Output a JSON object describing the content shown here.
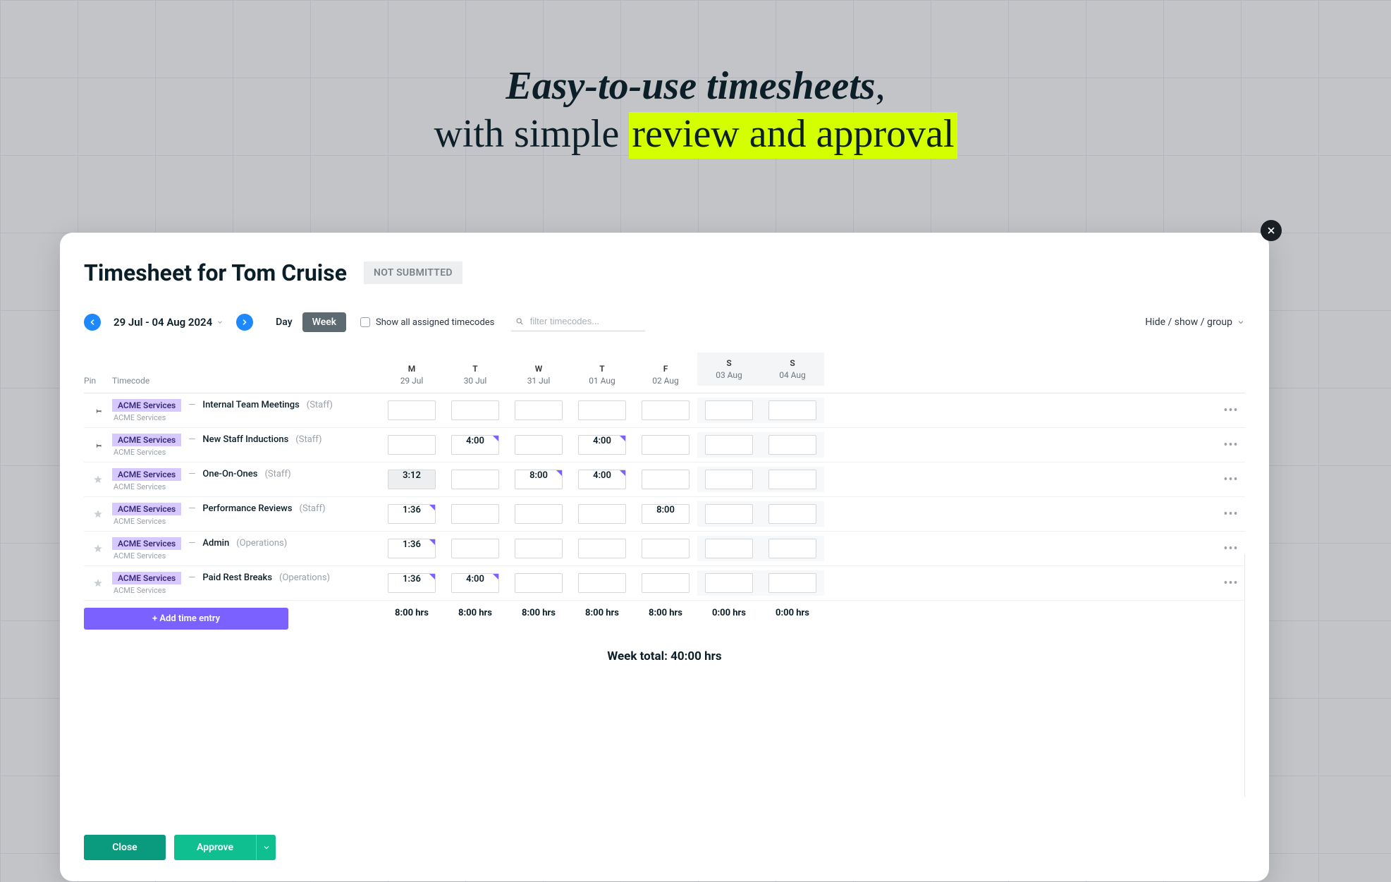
{
  "hero": {
    "line1": "Easy-to-use timesheets",
    "comma": ",",
    "line2_pre": "with simple ",
    "line2_hl": "review and approval"
  },
  "title": "Timesheet for Tom Cruise",
  "status": "NOT SUBMITTED",
  "toolbar": {
    "date_range": "29 Jul - 04 Aug 2024",
    "view_day": "Day",
    "view_week": "Week",
    "show_all_label": "Show all assigned timecodes",
    "filter_placeholder": "filter timecodes...",
    "hsg": "Hide / show / group"
  },
  "columns": {
    "pin": "Pin",
    "timecode": "Timecode",
    "days": [
      {
        "dow": "M",
        "date": "29 Jul",
        "weekend": false
      },
      {
        "dow": "T",
        "date": "30 Jul",
        "weekend": false
      },
      {
        "dow": "W",
        "date": "31 Jul",
        "weekend": false
      },
      {
        "dow": "T",
        "date": "01 Aug",
        "weekend": false
      },
      {
        "dow": "F",
        "date": "02 Aug",
        "weekend": false
      },
      {
        "dow": "S",
        "date": "03 Aug",
        "weekend": true
      },
      {
        "dow": "S",
        "date": "04 Aug",
        "weekend": true
      }
    ]
  },
  "rows": [
    {
      "pinned": true,
      "tag": "ACME Services",
      "name": "Internal Team Meetings",
      "suffix": "(Staff)",
      "sub": "ACME Services",
      "cells": [
        "",
        "",
        "",
        "",
        "",
        "",
        ""
      ]
    },
    {
      "pinned": true,
      "tag": "ACME Services",
      "name": "New Staff Inductions",
      "suffix": "(Staff)",
      "sub": "ACME Services",
      "cells": [
        "",
        "4:00",
        "",
        "4:00",
        "",
        "",
        ""
      ],
      "corner": [
        1,
        3
      ]
    },
    {
      "pinned": false,
      "tag": "ACME Services",
      "name": "One-On-Ones",
      "suffix": "(Staff)",
      "sub": "ACME Services",
      "cells": [
        "3:12",
        "",
        "8:00",
        "4:00",
        "",
        "",
        ""
      ],
      "corner": [
        2,
        3
      ],
      "greyed": [
        0
      ]
    },
    {
      "pinned": false,
      "tag": "ACME Services",
      "name": "Performance Reviews",
      "suffix": "(Staff)",
      "sub": "ACME Services",
      "cells": [
        "1:36",
        "",
        "",
        "",
        "8:00",
        "",
        ""
      ],
      "corner": [
        0
      ]
    },
    {
      "pinned": false,
      "tag": "ACME Services",
      "name": "Admin",
      "suffix": "(Operations)",
      "sub": "ACME Services",
      "cells": [
        "1:36",
        "",
        "",
        "",
        "",
        "",
        ""
      ],
      "corner": [
        0
      ]
    },
    {
      "pinned": false,
      "tag": "ACME Services",
      "name": "Paid Rest Breaks",
      "suffix": "(Operations)",
      "sub": "ACME Services",
      "cells": [
        "1:36",
        "4:00",
        "",
        "",
        "",
        "",
        ""
      ],
      "corner": [
        0,
        1
      ]
    }
  ],
  "totals": [
    "8:00 hrs",
    "8:00 hrs",
    "8:00 hrs",
    "8:00 hrs",
    "8:00 hrs",
    "0:00 hrs",
    "0:00 hrs"
  ],
  "add_time_entry": "+ Add time entry",
  "week_total": "Week total: 40:00 hrs",
  "footer": {
    "close": "Close",
    "approve": "Approve"
  }
}
